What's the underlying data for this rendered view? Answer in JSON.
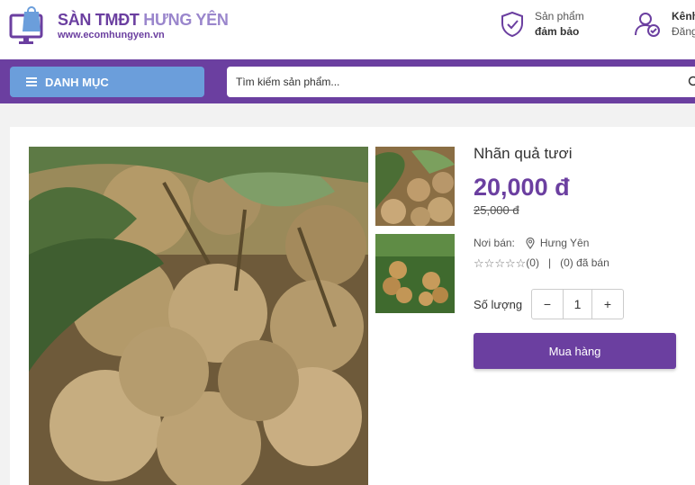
{
  "header": {
    "brand_part1": "SÀN TMĐT ",
    "brand_part2": "HƯNG YÊN",
    "brand_url": "www.ecomhungyen.vn",
    "guarantee_line1": "Sản phẩm",
    "guarantee_line2": "đảm bảo",
    "account_line1": "Kênh",
    "account_line2": "Đăng"
  },
  "nav": {
    "category_label": "DANH MỤC",
    "search_placeholder": "Tìm kiếm sản phẩm..."
  },
  "product": {
    "name": "Nhãn quả tươi",
    "price": "20,000 đ",
    "old_price": "25,000 đ",
    "seller_label": "Nơi bán:",
    "seller_location": "Hưng Yên",
    "rating_count": "(0)",
    "sold_text": "(0) đã bán",
    "qty_label": "Số lượng",
    "qty_minus": "−",
    "qty_value": "1",
    "qty_plus": "+",
    "buy_label": "Mua hàng"
  },
  "colors": {
    "brand_purple": "#6b3fa0",
    "category_blue": "#6b9edb"
  },
  "icons": [
    "logo-bag-icon",
    "shield-check-icon",
    "user-check-icon",
    "menu-icon",
    "search-icon",
    "location-pin-icon",
    "star-outline-icon"
  ]
}
